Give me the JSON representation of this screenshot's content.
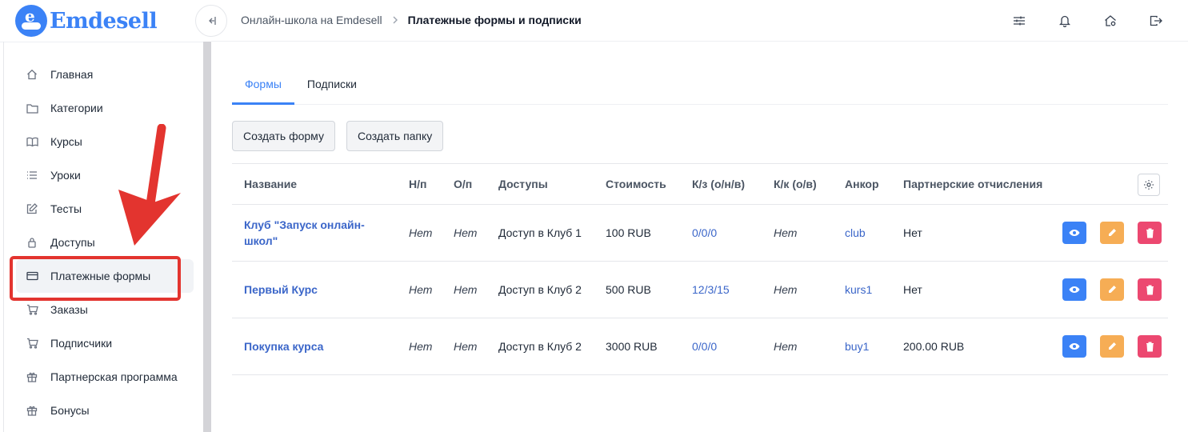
{
  "brand": {
    "name": "Emdesell",
    "logo_letter": "e"
  },
  "sidebar": {
    "items": [
      {
        "label": "Главная",
        "icon": "home-icon"
      },
      {
        "label": "Категории",
        "icon": "folder-icon"
      },
      {
        "label": "Курсы",
        "icon": "book-icon"
      },
      {
        "label": "Уроки",
        "icon": "list-icon"
      },
      {
        "label": "Тесты",
        "icon": "edit-icon"
      },
      {
        "label": "Доступы",
        "icon": "lock-icon"
      },
      {
        "label": "Платежные формы",
        "icon": "credit-card-icon",
        "active": true
      },
      {
        "label": "Заказы",
        "icon": "cart-icon"
      },
      {
        "label": "Подписчики",
        "icon": "cart-icon"
      },
      {
        "label": "Партнерская программа",
        "icon": "gift-icon"
      },
      {
        "label": "Бонусы",
        "icon": "gift-icon"
      }
    ]
  },
  "breadcrumb": {
    "parent": "Онлайн-школа на Emdesell",
    "separator": ">",
    "current": "Платежные формы и подписки"
  },
  "tabs": [
    {
      "label": "Формы",
      "active": true
    },
    {
      "label": "Подписки"
    }
  ],
  "toolbar": {
    "create_form": "Создать форму",
    "create_folder": "Создать папку"
  },
  "table": {
    "headers": {
      "name": "Название",
      "np": "Н/п",
      "op": "О/п",
      "access": "Доступы",
      "price": "Стоимость",
      "kz": "К/з (о/н/в)",
      "kk": "К/к (о/в)",
      "anchor": "Анкор",
      "partner": "Партнерские отчисления"
    },
    "rows": [
      {
        "name": "Клуб \"Запуск онлайн-школ\"",
        "np": "Нет",
        "op": "Нет",
        "access": "Доступ в Клуб 1",
        "price": "100 RUB",
        "kz": "0/0/0",
        "kk": "Нет",
        "anchor": "club",
        "partner": "Нет"
      },
      {
        "name": "Первый Курс",
        "np": "Нет",
        "op": "Нет",
        "access": "Доступ в Клуб 2",
        "price": "500 RUB",
        "kz": "12/3/15",
        "kk": "Нет",
        "anchor": "kurs1",
        "partner": "Нет"
      },
      {
        "name": "Покупка курса",
        "np": "Нет",
        "op": "Нет",
        "access": "Доступ в Клуб 2",
        "price": "3000 RUB",
        "kz": "0/0/0",
        "kk": "Нет",
        "anchor": "buy1",
        "partner": "200.00 RUB"
      }
    ]
  },
  "colors": {
    "accent": "#3b82f6",
    "view": "#3b82f6",
    "edit": "#f6ad55",
    "delete": "#ec4870",
    "annotation": "#e3342f"
  }
}
